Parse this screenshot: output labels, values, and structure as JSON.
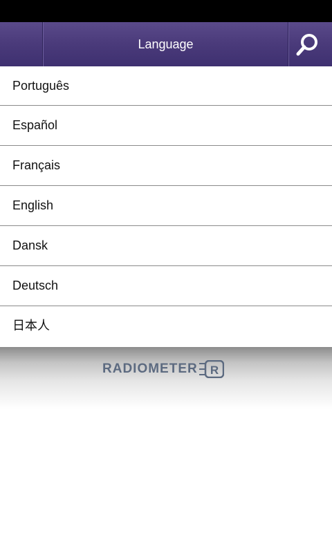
{
  "header": {
    "title": "Language"
  },
  "languages": [
    {
      "label": "Português"
    },
    {
      "label": "Español"
    },
    {
      "label": "Français"
    },
    {
      "label": "English"
    },
    {
      "label": "Dansk"
    },
    {
      "label": "Deutsch"
    },
    {
      "label": "日本人"
    }
  ],
  "footer": {
    "logo_text": "RADIOMETER",
    "logo_mark": "R"
  },
  "colors": {
    "header_bg": "#4a3a7a",
    "logo": "#5c6a80"
  },
  "icons": {
    "search": "search-icon"
  }
}
